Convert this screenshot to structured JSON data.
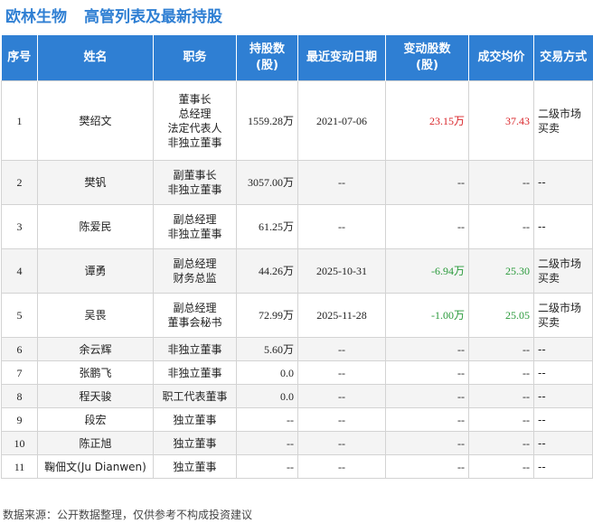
{
  "header": {
    "company": "欧林生物",
    "title": "高管列表及最新持股"
  },
  "table": {
    "columns": [
      "序号",
      "姓名",
      "职务",
      "持股数\n(股)",
      "最近变动日期",
      "变动股数\n(股)",
      "成交均价",
      "交易方式"
    ],
    "rows": [
      {
        "no": "1",
        "name": "樊绍文",
        "roles": [
          "董事长",
          "总经理",
          "法定代表人",
          "非独立董事"
        ],
        "shares": "1559.28万",
        "date": "2021-07-06",
        "change": "23.15万",
        "change_sign": "pos",
        "price": "37.43",
        "price_sign": "pos",
        "method": "二级市场买卖"
      },
      {
        "no": "2",
        "name": "樊钒",
        "roles": [
          "副董事长",
          "非独立董事"
        ],
        "shares": "3057.00万",
        "date": "--",
        "change": "--",
        "change_sign": "",
        "price": "--",
        "price_sign": "",
        "method": "--"
      },
      {
        "no": "3",
        "name": "陈爱民",
        "roles": [
          "副总经理",
          "非独立董事"
        ],
        "shares": "61.25万",
        "date": "--",
        "change": "--",
        "change_sign": "",
        "price": "--",
        "price_sign": "",
        "method": "--"
      },
      {
        "no": "4",
        "name": "谭勇",
        "roles": [
          "副总经理",
          "财务总监"
        ],
        "shares": "44.26万",
        "date": "2025-10-31",
        "change": "-6.94万",
        "change_sign": "neg",
        "price": "25.30",
        "price_sign": "neg",
        "method": "二级市场买卖"
      },
      {
        "no": "5",
        "name": "吴畏",
        "roles": [
          "副总经理",
          "董事会秘书"
        ],
        "shares": "72.99万",
        "date": "2025-11-28",
        "change": "-1.00万",
        "change_sign": "neg",
        "price": "25.05",
        "price_sign": "neg",
        "method": "二级市场买卖"
      },
      {
        "no": "6",
        "name": "余云辉",
        "roles": [
          "非独立董事"
        ],
        "shares": "5.60万",
        "date": "--",
        "change": "--",
        "change_sign": "",
        "price": "--",
        "price_sign": "",
        "method": "--"
      },
      {
        "no": "7",
        "name": "张鹏飞",
        "roles": [
          "非独立董事"
        ],
        "shares": "0.0",
        "date": "--",
        "change": "--",
        "change_sign": "",
        "price": "--",
        "price_sign": "",
        "method": "--"
      },
      {
        "no": "8",
        "name": "程天骏",
        "roles": [
          "职工代表董事"
        ],
        "shares": "0.0",
        "date": "--",
        "change": "--",
        "change_sign": "",
        "price": "--",
        "price_sign": "",
        "method": "--"
      },
      {
        "no": "9",
        "name": "段宏",
        "roles": [
          "独立董事"
        ],
        "shares": "--",
        "date": "--",
        "change": "--",
        "change_sign": "",
        "price": "--",
        "price_sign": "",
        "method": "--"
      },
      {
        "no": "10",
        "name": "陈正旭",
        "roles": [
          "独立董事"
        ],
        "shares": "--",
        "date": "--",
        "change": "--",
        "change_sign": "",
        "price": "--",
        "price_sign": "",
        "method": "--"
      },
      {
        "no": "11",
        "name": "鞠佃文(Ju Dianwen)",
        "roles": [
          "独立董事"
        ],
        "shares": "--",
        "date": "--",
        "change": "--",
        "change_sign": "",
        "price": "--",
        "price_sign": "",
        "method": "--"
      }
    ]
  },
  "footer": {
    "source": "数据来源：公开数据整理，仅供参考不构成投资建议"
  },
  "colors": {
    "accent": "#2f7fd3",
    "up": "#d9252a",
    "down": "#2a9a3b"
  }
}
